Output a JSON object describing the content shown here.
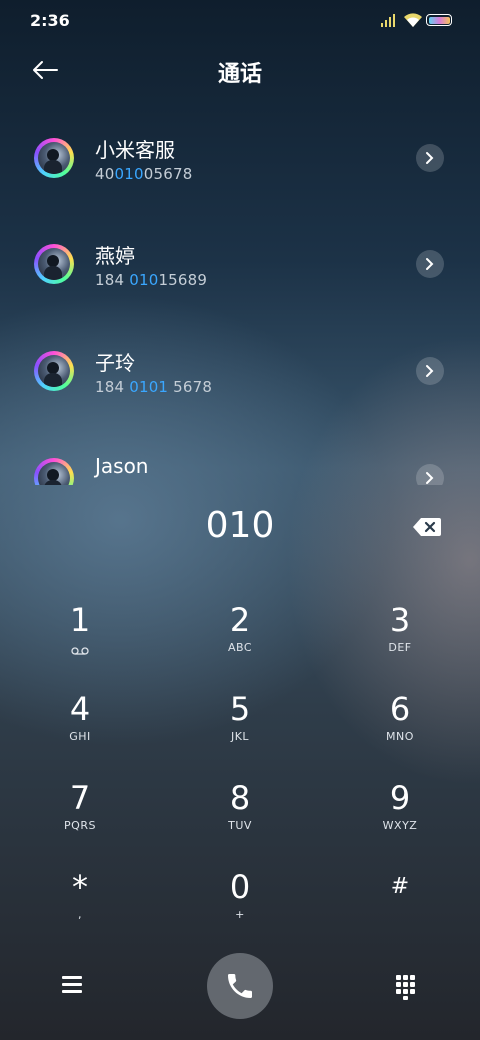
{
  "status_bar": {
    "time": "2:36"
  },
  "header": {
    "title": "通话"
  },
  "contacts": [
    {
      "name": "小米客服",
      "number_pre": "40",
      "number_match": "010",
      "number_post": "05678"
    },
    {
      "name": "燕婷",
      "number_pre": "184 ",
      "number_match": "010",
      "number_post": "15689"
    },
    {
      "name": "子玲",
      "number_pre": "184 ",
      "number_match": "0101",
      "number_post": " 5678"
    },
    {
      "name": "Jason",
      "number_pre": "",
      "number_match": "",
      "number_post": ""
    }
  ],
  "dial": {
    "entered": "010"
  },
  "keys": [
    {
      "digit": "1",
      "letters": ""
    },
    {
      "digit": "2",
      "letters": "ABC"
    },
    {
      "digit": "3",
      "letters": "DEF"
    },
    {
      "digit": "4",
      "letters": "GHI"
    },
    {
      "digit": "5",
      "letters": "JKL"
    },
    {
      "digit": "6",
      "letters": "MNO"
    },
    {
      "digit": "7",
      "letters": "PQRS"
    },
    {
      "digit": "8",
      "letters": "TUV"
    },
    {
      "digit": "9",
      "letters": "WXYZ"
    },
    {
      "digit": "*",
      "letters": ","
    },
    {
      "digit": "0",
      "letters": "+"
    },
    {
      "digit": "#",
      "letters": ""
    }
  ],
  "colors": {
    "match_highlight": "#3aa7ff",
    "battery_fill": "gradient"
  },
  "icons": {
    "back": "arrow-left-icon",
    "delete": "backspace-icon",
    "voicemail": "voicemail-icon",
    "menu": "hamburger-icon",
    "call": "phone-icon",
    "keypad": "dialpad-icon"
  }
}
